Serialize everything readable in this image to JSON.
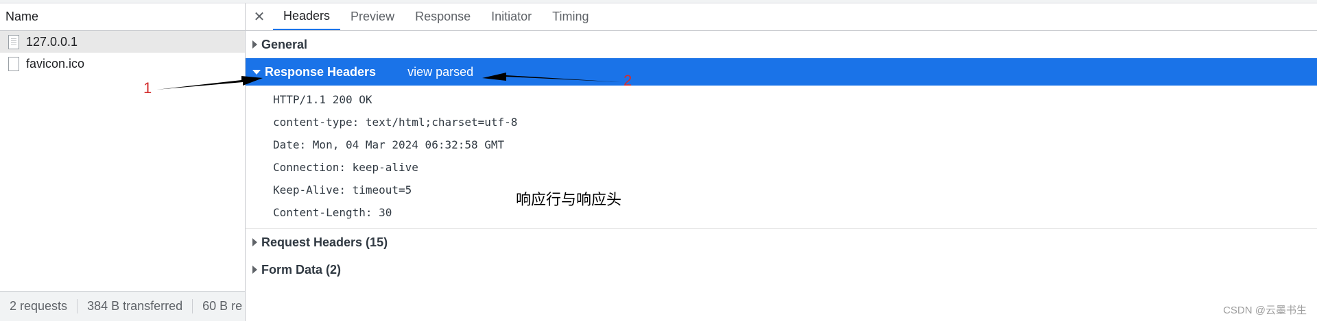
{
  "left_pane": {
    "header": "Name",
    "requests": [
      {
        "name": "127.0.0.1",
        "selected": true
      },
      {
        "name": "favicon.ico",
        "selected": false
      }
    ],
    "status": {
      "requests": "2 requests",
      "transferred": "384 B transferred",
      "resources": "60 B re"
    }
  },
  "detail": {
    "close_icon": "close-icon",
    "tabs": [
      "Headers",
      "Preview",
      "Response",
      "Initiator",
      "Timing"
    ],
    "active_tab": "Headers",
    "sections": {
      "general": "General",
      "response_headers": "Response Headers",
      "view_parsed": "view parsed",
      "request_headers": "Request Headers (15)",
      "form_data": "Form Data (2)"
    },
    "response_lines": [
      "HTTP/1.1 200 OK",
      "content-type: text/html;charset=utf-8",
      "Date: Mon, 04 Mar 2024 06:32:58 GMT",
      "Connection: keep-alive",
      "Keep-Alive: timeout=5",
      "Content-Length: 30"
    ]
  },
  "annotations": {
    "label_1": "1",
    "label_2": "2",
    "note": "响应行与响应头",
    "color": "#d32f2f"
  },
  "watermark": "CSDN @云墨书生",
  "colors": {
    "highlight": "#1a73e8",
    "selected_row": "#e8e8e8"
  }
}
